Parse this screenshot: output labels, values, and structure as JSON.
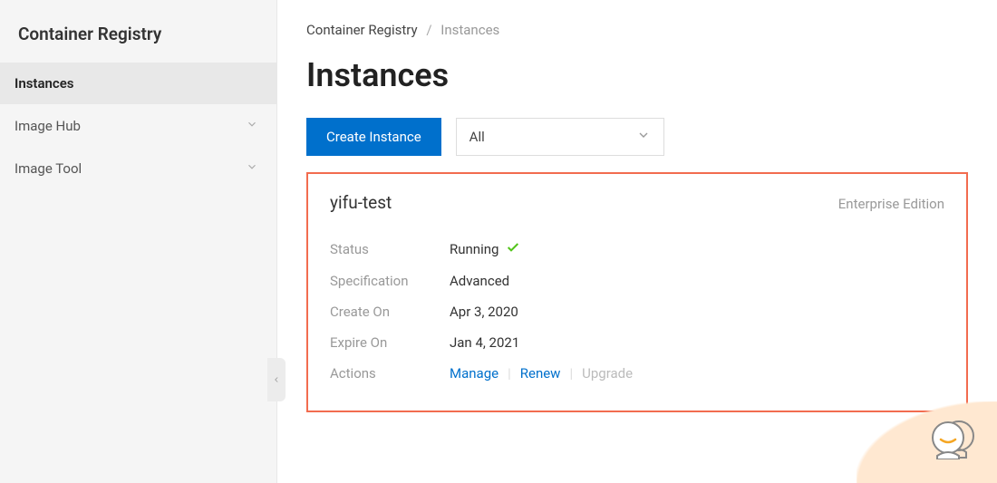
{
  "sidebar": {
    "title": "Container Registry",
    "items": [
      {
        "label": "Instances",
        "expandable": false,
        "active": true
      },
      {
        "label": "Image Hub",
        "expandable": true,
        "active": false
      },
      {
        "label": "Image Tool",
        "expandable": true,
        "active": false
      }
    ]
  },
  "breadcrumb": {
    "root": "Container Registry",
    "current": "Instances"
  },
  "page": {
    "title": "Instances"
  },
  "toolbar": {
    "create_label": "Create Instance",
    "filter_value": "All"
  },
  "instance": {
    "name": "yifu-test",
    "edition": "Enterprise Edition",
    "rows": {
      "status_label": "Status",
      "status_value": "Running",
      "spec_label": "Specification",
      "spec_value": "Advanced",
      "created_label": "Create On",
      "created_value": "Apr 3, 2020",
      "expire_label": "Expire On",
      "expire_value": "Jan 4, 2021",
      "actions_label": "Actions",
      "action_manage": "Manage",
      "action_renew": "Renew",
      "action_upgrade": "Upgrade"
    }
  }
}
